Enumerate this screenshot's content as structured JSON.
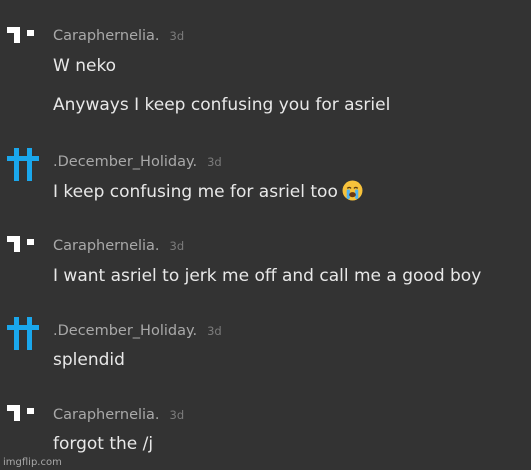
{
  "messages": [
    {
      "username": "Caraphernelia.",
      "time": "3d",
      "avatar": "pixel-cat-icon",
      "lines": [
        "W neko",
        "Anyways I keep confusing you for asriel"
      ]
    },
    {
      "username": ".December_Holiday.",
      "time": "3d",
      "avatar": "blue-double-cross-icon",
      "lines": [
        "I keep confusing me for asriel too"
      ],
      "emoji": "loudly-crying-face-emoji"
    },
    {
      "username": "Caraphernelia.",
      "time": "3d",
      "avatar": "pixel-cat-icon",
      "lines": [
        "I want asriel to jerk me off and call me a good boy"
      ]
    },
    {
      "username": ".December_Holiday.",
      "time": "3d",
      "avatar": "blue-double-cross-icon",
      "lines": [
        "splendid"
      ]
    },
    {
      "username": "Caraphernelia.",
      "time": "3d",
      "avatar": "pixel-cat-icon",
      "lines": [
        "forgot the /j"
      ]
    }
  ],
  "watermark": "imgflip.com",
  "colors": {
    "background": "#333333",
    "username": "#a9a9a9",
    "timestamp": "#7c7c7c",
    "message_text": "#e8e8e8",
    "december_avatar": "#1aa7ec"
  }
}
